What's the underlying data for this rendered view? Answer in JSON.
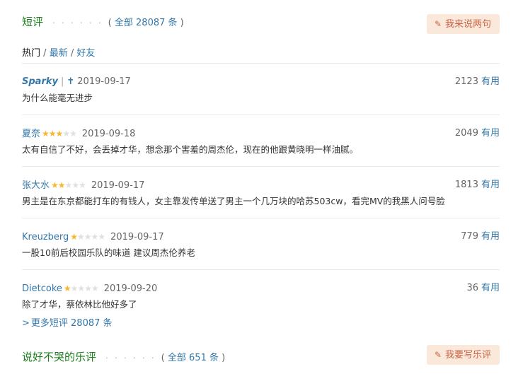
{
  "short_reviews": {
    "title": "短评",
    "dots": "· · · · · ·",
    "total_label": "全部 28087 条",
    "button_label": "我来说两句",
    "tabs": [
      {
        "label": "热门"
      },
      {
        "label": "最新"
      },
      {
        "label": "好友"
      }
    ],
    "tab_separator": "/",
    "comments": [
      {
        "user": "Sparky",
        "badge": "✝",
        "date": "2019-09-17",
        "stars": 0,
        "votes": "2123",
        "useful_label": "有用",
        "text": "为什么能毫无进步"
      },
      {
        "user": "夏奈",
        "date": "2019-09-18",
        "stars": 3,
        "votes": "2049",
        "useful_label": "有用",
        "text": "太有自信了不好，会丢掉才华，想念那个害羞的周杰伦，现在的他跟黄晓明一样油腻。"
      },
      {
        "user": "张大水",
        "date": "2019-09-17",
        "stars": 2,
        "votes": "1813",
        "useful_label": "有用",
        "text": "男主是在东京都能打车的有钱人，女主靠发传单送了男主一个几万块的哈苏503cw，看完MV的我黑人问号脸"
      },
      {
        "user": "Kreuzberg",
        "date": "2019-09-17",
        "stars": 1,
        "votes": "779",
        "useful_label": "有用",
        "text": "一股10前后校园乐队的味道 建议周杰伦养老"
      },
      {
        "user": "Dietcoke",
        "date": "2019-09-20",
        "stars": 1,
        "votes": "36",
        "useful_label": "有用",
        "text": "除了才华，蔡依林比他好多了"
      }
    ],
    "more_label": "更多短评 28087 条"
  },
  "music_reviews": {
    "title": "说好不哭的乐评",
    "dots": "· · · · · ·",
    "total_label": "全部 651 条",
    "button_label": "我要写乐评"
  },
  "colors": {
    "title_green": "#1a7f1a",
    "link_blue": "#3377aa",
    "button_bg": "#fae9da",
    "button_text": "#ca6445",
    "star": "#f7b630"
  }
}
